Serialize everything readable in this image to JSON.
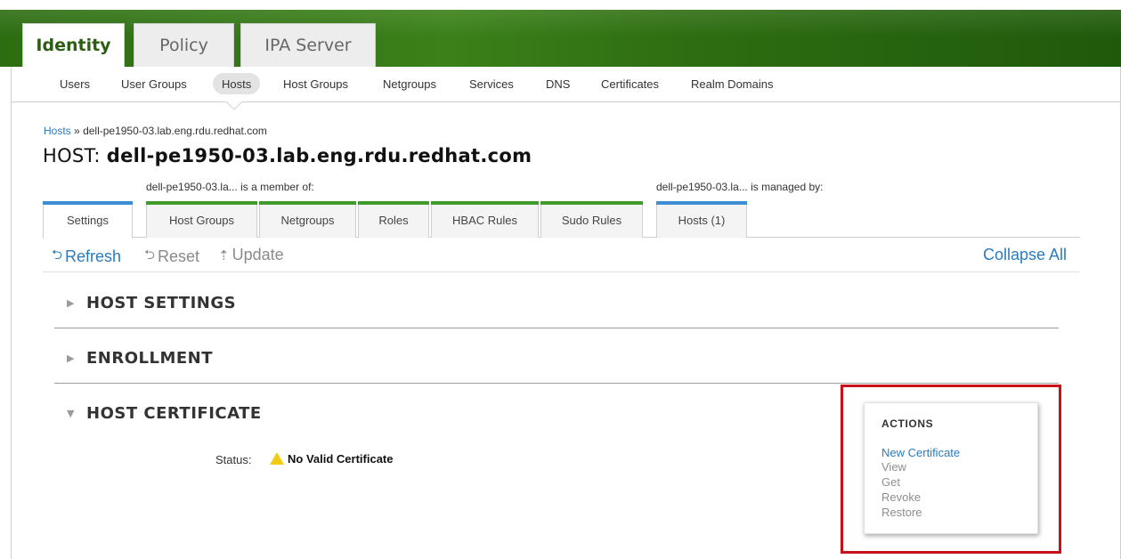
{
  "header": {
    "tabs": [
      {
        "label": "Identity",
        "active": true
      },
      {
        "label": "Policy",
        "active": false
      },
      {
        "label": "IPA Server",
        "active": false
      }
    ],
    "brand_color": "#2b5d12"
  },
  "subnav": {
    "items": [
      "Users",
      "User Groups",
      "Hosts",
      "Host Groups",
      "Netgroups",
      "Services",
      "DNS",
      "Certificates",
      "Realm Domains"
    ],
    "active": "Hosts"
  },
  "breadcrumb": {
    "link": "Hosts",
    "separator": "»",
    "current": "dell-pe1950-03.lab.eng.rdu.redhat.com"
  },
  "page": {
    "title_prefix": "HOST:",
    "title_name": "dell-pe1950-03.lab.eng.rdu.redhat.com",
    "member_of_label": "dell-pe1950-03.la... is a member of:",
    "managed_by_label": "dell-pe1950-03.la... is managed by:"
  },
  "facet_tabs": [
    {
      "label": "Settings",
      "active": true,
      "group": "details"
    },
    {
      "label": "Host Groups",
      "active": false,
      "group": "member"
    },
    {
      "label": "Netgroups",
      "active": false,
      "group": "member"
    },
    {
      "label": "Roles",
      "active": false,
      "group": "member"
    },
    {
      "label": "HBAC Rules",
      "active": false,
      "group": "member"
    },
    {
      "label": "Sudo Rules",
      "active": false,
      "group": "member"
    },
    {
      "label": "Hosts (1)",
      "active": false,
      "group": "managed"
    }
  ],
  "toolbar": {
    "refresh": "Refresh",
    "reset": "Reset",
    "update": "Update",
    "collapse_all": "Collapse All",
    "refresh_icon": "refresh-icon",
    "reset_icon": "reset-icon",
    "update_icon": "update-arrow-icon"
  },
  "sections": [
    {
      "title": "HOST SETTINGS",
      "expanded": false
    },
    {
      "title": "ENROLLMENT",
      "expanded": false
    },
    {
      "title": "HOST CERTIFICATE",
      "expanded": true
    }
  ],
  "certificate": {
    "status_label": "Status:",
    "status_value": "No Valid Certificate",
    "status_icon": "warning-icon"
  },
  "actions": {
    "title": "ACTIONS",
    "items": [
      {
        "label": "New Certificate",
        "enabled": true
      },
      {
        "label": "View",
        "enabled": false
      },
      {
        "label": "Get",
        "enabled": false
      },
      {
        "label": "Revoke",
        "enabled": false
      },
      {
        "label": "Restore",
        "enabled": false
      }
    ]
  },
  "colors": {
    "link": "#2a7bbf",
    "highlight": "#c8101a",
    "warning": "#f0cb13",
    "tab_blue": "#3d8fd1",
    "tab_green": "#3f9b2a"
  }
}
